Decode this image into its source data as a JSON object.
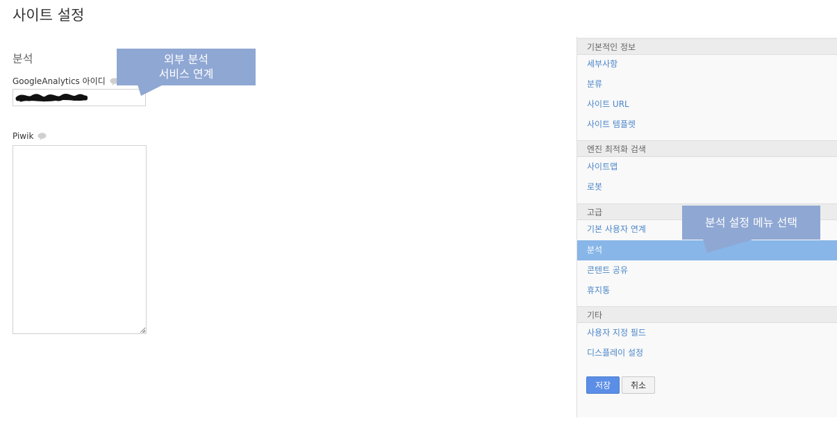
{
  "page": {
    "title": "사이트 설정"
  },
  "analytics": {
    "section_title": "분석",
    "ga_label": "GoogleAnalytics 아이디",
    "piwik_label": "Piwik"
  },
  "callouts": {
    "external_service_line1": "외부 분석",
    "external_service_line2": "서비스 연계",
    "menu_select": "분석 설정 메뉴 선택"
  },
  "sidebar": {
    "groups": [
      {
        "header": "기본적인 정보",
        "items": [
          "세부사항",
          "분류",
          "사이트 URL",
          "사이트 템플렛"
        ]
      },
      {
        "header": "엔진 최적화 검색",
        "items": [
          "사이트맵",
          "로봇"
        ]
      },
      {
        "header": "고급",
        "items": [
          "기본 사용자 연계",
          "분석",
          "콘텐트 공유",
          "휴지통"
        ]
      },
      {
        "header": "기타",
        "items": [
          "사용자 지정 필드",
          "디스플레이 설정"
        ]
      }
    ],
    "active_item": "분석"
  },
  "actions": {
    "save_label": "저장",
    "cancel_label": "취소"
  },
  "colors": {
    "accent": "#4a86c8",
    "active_bg": "#88b6e8",
    "callout_bg": "#8fa7d3",
    "save_bg": "#5b8ee6"
  },
  "icons": {
    "help": "question-bubble-icon"
  }
}
